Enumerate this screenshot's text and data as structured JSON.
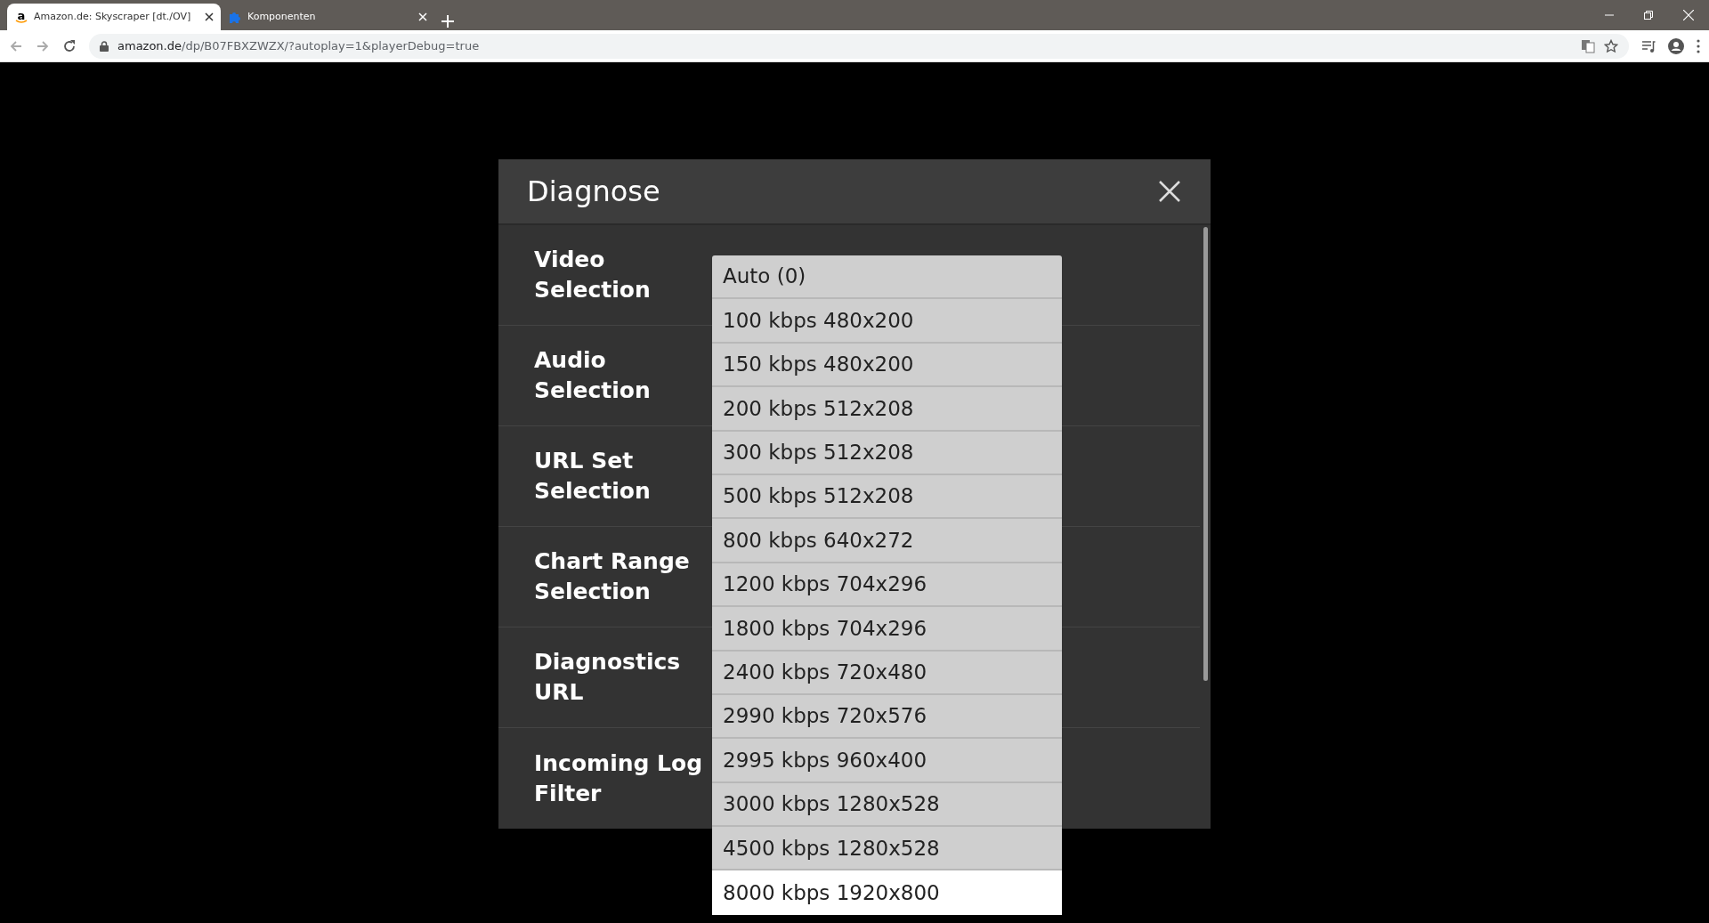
{
  "browser": {
    "tabs": [
      {
        "title": "Amazon.de: Skyscraper [dt./OV]",
        "selected": true,
        "kind": "amazon",
        "favicon_letter": "a"
      },
      {
        "title": "Komponenten",
        "selected": false,
        "kind": "puzzle"
      }
    ],
    "address": {
      "host": "amazon.de",
      "path": "/dp/B07FBXZWZX/?autoplay=1&playerDebug=true"
    }
  },
  "dialog": {
    "title": "Diagnose",
    "rows": [
      {
        "label": "Video Selection"
      },
      {
        "label": "Audio Selection"
      },
      {
        "label": "URL Set Selection"
      },
      {
        "label": "Chart Range Selection"
      },
      {
        "label": "Diagnostics URL"
      },
      {
        "label": "Incoming Log Filter"
      }
    ],
    "dropdown": {
      "options": [
        {
          "label": "Auto (0)",
          "selected": false
        },
        {
          "label": "100 kbps 480x200",
          "selected": false
        },
        {
          "label": "150 kbps 480x200",
          "selected": false
        },
        {
          "label": "200 kbps 512x208",
          "selected": false
        },
        {
          "label": "300 kbps 512x208",
          "selected": false
        },
        {
          "label": "500 kbps 512x208",
          "selected": false
        },
        {
          "label": "800 kbps 640x272",
          "selected": false
        },
        {
          "label": "1200 kbps 704x296",
          "selected": false
        },
        {
          "label": "1800 kbps 704x296",
          "selected": false
        },
        {
          "label": "2400 kbps 720x480",
          "selected": false
        },
        {
          "label": "2990 kbps 720x576",
          "selected": false
        },
        {
          "label": "2995 kbps 960x400",
          "selected": false
        },
        {
          "label": "3000 kbps 1280x528",
          "selected": false
        },
        {
          "label": "4500 kbps 1280x528",
          "selected": false
        },
        {
          "label": "8000 kbps 1920x800",
          "selected": true
        }
      ]
    }
  }
}
